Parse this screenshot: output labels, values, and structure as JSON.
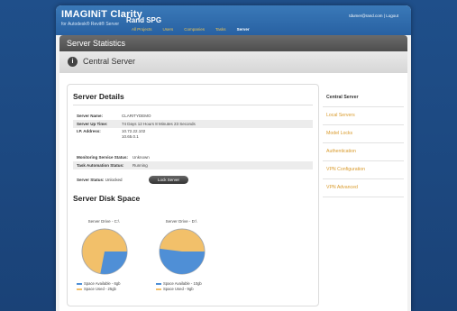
{
  "brand": {
    "name": "IMAGINiT Clarity",
    "subtitle": "for Autodesk® Revit® Server",
    "company": "Rand SPG"
  },
  "nav": {
    "items": [
      "All Projects",
      "Users",
      "Companies",
      "Tasks",
      "Server"
    ],
    "active_index": 4
  },
  "user": {
    "email": "tdumer@rand.com",
    "separator": "|",
    "logout": "Logout"
  },
  "section": {
    "title": "Server Statistics"
  },
  "context": {
    "icon": "server-icon",
    "title": "Central Server"
  },
  "details": {
    "title": "Server Details",
    "rows": [
      {
        "label": "Server Name:",
        "value": "CLARITYDEMO"
      },
      {
        "label": "Server Up Time:",
        "value": "74 Days 12 Hours 8 Minutes 23 Seconds"
      },
      {
        "label": "I.P. Address:",
        "value": "10.72.22.102"
      },
      {
        "label": "",
        "value": "10.65.0.1"
      },
      {
        "label": "Monitoring Service Status:",
        "value": "Unknown"
      },
      {
        "label": "Task Automation Status:",
        "value": "Running"
      }
    ],
    "server_status_label": "Server Status:",
    "server_status_value": "Unlocked",
    "lock_button": "Lock Server"
  },
  "disk": {
    "title": "Server Disk Space",
    "drives": [
      {
        "title": "Server Drive - C:\\",
        "available_fraction": 0.28,
        "legend_available": "Space Available - 6gb",
        "legend_used": "Space Used - 25gb"
      },
      {
        "title": "Server Drive - D:\\",
        "available_fraction": 0.52,
        "legend_available": "Space Available - 10gb",
        "legend_used": "Space Used - 9gb"
      }
    ],
    "colors": {
      "available": "#4f8fd6",
      "used": "#f2c06a"
    }
  },
  "sidebar": {
    "items": [
      "Central Server",
      "Local Servers",
      "Model Locks",
      "Authentication",
      "VPN Configuration",
      "VPN Advanced"
    ],
    "active_index": 0
  }
}
